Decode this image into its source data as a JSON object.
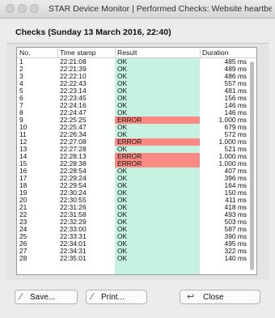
{
  "window": {
    "title": "STAR Device Monitor | Performed Checks: Website heartbeat"
  },
  "heading": "Checks (Sunday 13 March 2016, 22:40)",
  "table": {
    "headers": {
      "no": "No.",
      "timestamp": "Time stamp",
      "result": "Result",
      "duration": "Duration"
    },
    "rows": [
      {
        "no": "1",
        "timestamp": "22:21:08",
        "result": "OK",
        "duration": "485 ms",
        "status": "ok"
      },
      {
        "no": "2",
        "timestamp": "22:21:39",
        "result": "OK",
        "duration": "489 ms",
        "status": "ok"
      },
      {
        "no": "3",
        "timestamp": "22:22:10",
        "result": "OK",
        "duration": "486 ms",
        "status": "ok"
      },
      {
        "no": "4",
        "timestamp": "22:22:43",
        "result": "OK",
        "duration": "557 ms",
        "status": "ok"
      },
      {
        "no": "5",
        "timestamp": "22:23:14",
        "result": "OK",
        "duration": "481 ms",
        "status": "ok"
      },
      {
        "no": "6",
        "timestamp": "22:23:45",
        "result": "OK",
        "duration": "156 ms",
        "status": "ok"
      },
      {
        "no": "7",
        "timestamp": "22:24:16",
        "result": "OK",
        "duration": "146 ms",
        "status": "ok"
      },
      {
        "no": "8",
        "timestamp": "22:24:47",
        "result": "OK",
        "duration": "146 ms",
        "status": "ok"
      },
      {
        "no": "9",
        "timestamp": "22:25:25",
        "result": "ERROR",
        "duration": "1.000 ms",
        "status": "error"
      },
      {
        "no": "10",
        "timestamp": "22:25:47",
        "result": "OK",
        "duration": "679 ms",
        "status": "ok"
      },
      {
        "no": "11",
        "timestamp": "22:26:34",
        "result": "OK",
        "duration": "572 ms",
        "status": "ok"
      },
      {
        "no": "12",
        "timestamp": "22:27:08",
        "result": "ERROR",
        "duration": "1.000 ms",
        "status": "error"
      },
      {
        "no": "13",
        "timestamp": "22:27:28",
        "result": "OK",
        "duration": "521 ms",
        "status": "ok"
      },
      {
        "no": "14",
        "timestamp": "22:28:13",
        "result": "ERROR",
        "duration": "1.000 ms",
        "status": "error"
      },
      {
        "no": "15",
        "timestamp": "22:28:38",
        "result": "ERROR",
        "duration": "1.000 ms",
        "status": "error"
      },
      {
        "no": "16",
        "timestamp": "22:28:54",
        "result": "OK",
        "duration": "407 ms",
        "status": "ok"
      },
      {
        "no": "17",
        "timestamp": "22:29:24",
        "result": "OK",
        "duration": "396 ms",
        "status": "ok"
      },
      {
        "no": "18",
        "timestamp": "22:29:54",
        "result": "OK",
        "duration": "164 ms",
        "status": "ok"
      },
      {
        "no": "19",
        "timestamp": "22:30:24",
        "result": "OK",
        "duration": "150 ms",
        "status": "ok"
      },
      {
        "no": "20",
        "timestamp": "22:30:55",
        "result": "OK",
        "duration": "411 ms",
        "status": "ok"
      },
      {
        "no": "21",
        "timestamp": "22:31:26",
        "result": "OK",
        "duration": "418 ms",
        "status": "ok"
      },
      {
        "no": "22",
        "timestamp": "22:31:58",
        "result": "OK",
        "duration": "493 ms",
        "status": "ok"
      },
      {
        "no": "23",
        "timestamp": "22:32:29",
        "result": "OK",
        "duration": "503 ms",
        "status": "ok"
      },
      {
        "no": "24",
        "timestamp": "22:33:00",
        "result": "OK",
        "duration": "587 ms",
        "status": "ok"
      },
      {
        "no": "25",
        "timestamp": "22:33:31",
        "result": "OK",
        "duration": "390 ms",
        "status": "ok"
      },
      {
        "no": "26",
        "timestamp": "22:34:01",
        "result": "OK",
        "duration": "495 ms",
        "status": "ok"
      },
      {
        "no": "27",
        "timestamp": "22:34:31",
        "result": "OK",
        "duration": "322 ms",
        "status": "ok"
      },
      {
        "no": "28",
        "timestamp": "22:35:01",
        "result": "OK",
        "duration": "140 ms",
        "status": "ok"
      }
    ]
  },
  "buttons": {
    "save": "Save...",
    "print": "Print...",
    "close": "Close"
  },
  "icons": {
    "save": "pencil-icon",
    "print": "pencil-icon",
    "close": "return-arrow-icon"
  },
  "colors": {
    "ok_bg": "#c6f2e2",
    "error_bg": "#fb8a84"
  }
}
